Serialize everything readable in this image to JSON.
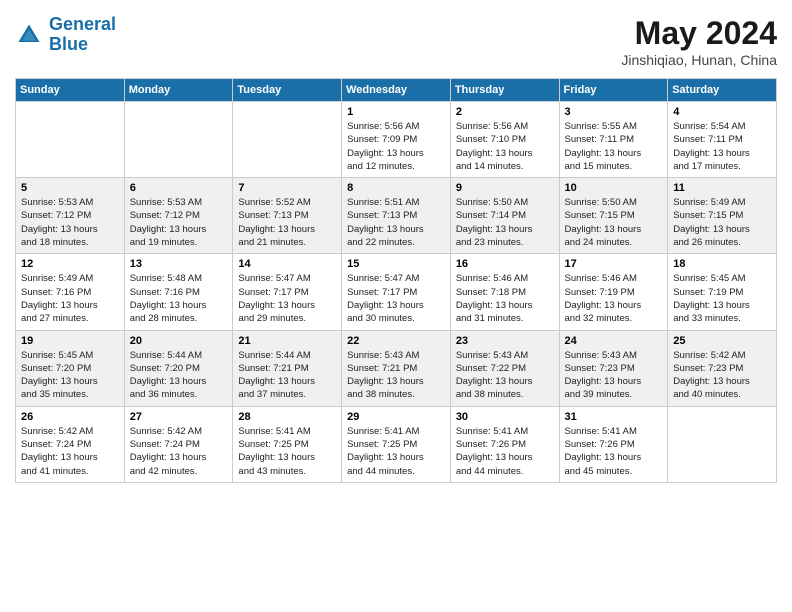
{
  "header": {
    "logo_line1": "General",
    "logo_line2": "Blue",
    "month_title": "May 2024",
    "location": "Jinshiqiao, Hunan, China"
  },
  "weekdays": [
    "Sunday",
    "Monday",
    "Tuesday",
    "Wednesday",
    "Thursday",
    "Friday",
    "Saturday"
  ],
  "weeks": [
    [
      {
        "day": "",
        "info": ""
      },
      {
        "day": "",
        "info": ""
      },
      {
        "day": "",
        "info": ""
      },
      {
        "day": "1",
        "info": "Sunrise: 5:56 AM\nSunset: 7:09 PM\nDaylight: 13 hours\nand 12 minutes."
      },
      {
        "day": "2",
        "info": "Sunrise: 5:56 AM\nSunset: 7:10 PM\nDaylight: 13 hours\nand 14 minutes."
      },
      {
        "day": "3",
        "info": "Sunrise: 5:55 AM\nSunset: 7:11 PM\nDaylight: 13 hours\nand 15 minutes."
      },
      {
        "day": "4",
        "info": "Sunrise: 5:54 AM\nSunset: 7:11 PM\nDaylight: 13 hours\nand 17 minutes."
      }
    ],
    [
      {
        "day": "5",
        "info": "Sunrise: 5:53 AM\nSunset: 7:12 PM\nDaylight: 13 hours\nand 18 minutes."
      },
      {
        "day": "6",
        "info": "Sunrise: 5:53 AM\nSunset: 7:12 PM\nDaylight: 13 hours\nand 19 minutes."
      },
      {
        "day": "7",
        "info": "Sunrise: 5:52 AM\nSunset: 7:13 PM\nDaylight: 13 hours\nand 21 minutes."
      },
      {
        "day": "8",
        "info": "Sunrise: 5:51 AM\nSunset: 7:13 PM\nDaylight: 13 hours\nand 22 minutes."
      },
      {
        "day": "9",
        "info": "Sunrise: 5:50 AM\nSunset: 7:14 PM\nDaylight: 13 hours\nand 23 minutes."
      },
      {
        "day": "10",
        "info": "Sunrise: 5:50 AM\nSunset: 7:15 PM\nDaylight: 13 hours\nand 24 minutes."
      },
      {
        "day": "11",
        "info": "Sunrise: 5:49 AM\nSunset: 7:15 PM\nDaylight: 13 hours\nand 26 minutes."
      }
    ],
    [
      {
        "day": "12",
        "info": "Sunrise: 5:49 AM\nSunset: 7:16 PM\nDaylight: 13 hours\nand 27 minutes."
      },
      {
        "day": "13",
        "info": "Sunrise: 5:48 AM\nSunset: 7:16 PM\nDaylight: 13 hours\nand 28 minutes."
      },
      {
        "day": "14",
        "info": "Sunrise: 5:47 AM\nSunset: 7:17 PM\nDaylight: 13 hours\nand 29 minutes."
      },
      {
        "day": "15",
        "info": "Sunrise: 5:47 AM\nSunset: 7:17 PM\nDaylight: 13 hours\nand 30 minutes."
      },
      {
        "day": "16",
        "info": "Sunrise: 5:46 AM\nSunset: 7:18 PM\nDaylight: 13 hours\nand 31 minutes."
      },
      {
        "day": "17",
        "info": "Sunrise: 5:46 AM\nSunset: 7:19 PM\nDaylight: 13 hours\nand 32 minutes."
      },
      {
        "day": "18",
        "info": "Sunrise: 5:45 AM\nSunset: 7:19 PM\nDaylight: 13 hours\nand 33 minutes."
      }
    ],
    [
      {
        "day": "19",
        "info": "Sunrise: 5:45 AM\nSunset: 7:20 PM\nDaylight: 13 hours\nand 35 minutes."
      },
      {
        "day": "20",
        "info": "Sunrise: 5:44 AM\nSunset: 7:20 PM\nDaylight: 13 hours\nand 36 minutes."
      },
      {
        "day": "21",
        "info": "Sunrise: 5:44 AM\nSunset: 7:21 PM\nDaylight: 13 hours\nand 37 minutes."
      },
      {
        "day": "22",
        "info": "Sunrise: 5:43 AM\nSunset: 7:21 PM\nDaylight: 13 hours\nand 38 minutes."
      },
      {
        "day": "23",
        "info": "Sunrise: 5:43 AM\nSunset: 7:22 PM\nDaylight: 13 hours\nand 38 minutes."
      },
      {
        "day": "24",
        "info": "Sunrise: 5:43 AM\nSunset: 7:23 PM\nDaylight: 13 hours\nand 39 minutes."
      },
      {
        "day": "25",
        "info": "Sunrise: 5:42 AM\nSunset: 7:23 PM\nDaylight: 13 hours\nand 40 minutes."
      }
    ],
    [
      {
        "day": "26",
        "info": "Sunrise: 5:42 AM\nSunset: 7:24 PM\nDaylight: 13 hours\nand 41 minutes."
      },
      {
        "day": "27",
        "info": "Sunrise: 5:42 AM\nSunset: 7:24 PM\nDaylight: 13 hours\nand 42 minutes."
      },
      {
        "day": "28",
        "info": "Sunrise: 5:41 AM\nSunset: 7:25 PM\nDaylight: 13 hours\nand 43 minutes."
      },
      {
        "day": "29",
        "info": "Sunrise: 5:41 AM\nSunset: 7:25 PM\nDaylight: 13 hours\nand 44 minutes."
      },
      {
        "day": "30",
        "info": "Sunrise: 5:41 AM\nSunset: 7:26 PM\nDaylight: 13 hours\nand 44 minutes."
      },
      {
        "day": "31",
        "info": "Sunrise: 5:41 AM\nSunset: 7:26 PM\nDaylight: 13 hours\nand 45 minutes."
      },
      {
        "day": "",
        "info": ""
      }
    ]
  ]
}
